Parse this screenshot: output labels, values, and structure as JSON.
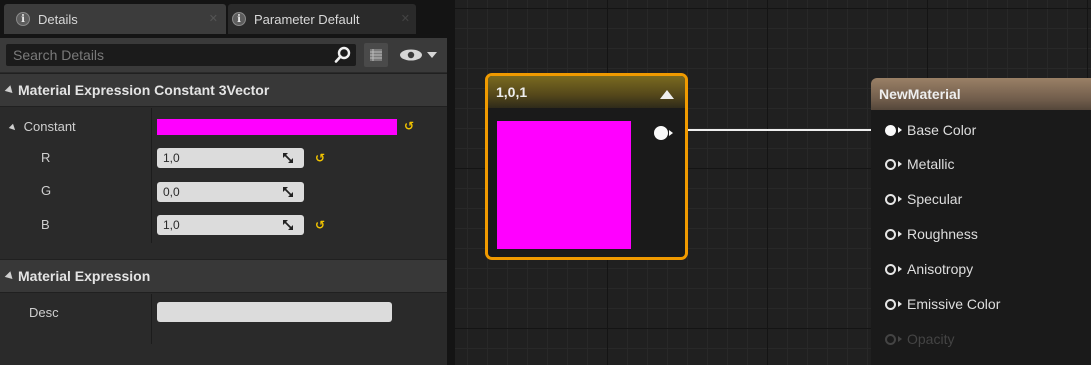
{
  "details_panel": {
    "tabs": [
      {
        "label": "Details",
        "icon": "info-icon"
      },
      {
        "label": "Parameter Default",
        "icon": "info-icon"
      }
    ],
    "search": {
      "placeholder": "Search Details",
      "value": ""
    },
    "categories": [
      {
        "title": "Material Expression Constant 3Vector",
        "properties": [
          {
            "label": "Constant",
            "value_color": "#ff00ff"
          },
          {
            "label": "R",
            "value": "1,0"
          },
          {
            "label": "G",
            "value": "0,0"
          },
          {
            "label": "B",
            "value": "1,0"
          }
        ]
      },
      {
        "title": "Material Expression",
        "properties": [
          {
            "label": "Desc",
            "value": ""
          }
        ]
      }
    ]
  },
  "graph": {
    "constant_node": {
      "title": "1,0,1",
      "preview_color": "#ff00ff"
    },
    "material_node": {
      "title": "NewMaterial",
      "pins": [
        {
          "label": "Base Color",
          "connected": true
        },
        {
          "label": "Metallic"
        },
        {
          "label": "Specular"
        },
        {
          "label": "Roughness"
        },
        {
          "label": "Anisotropy"
        },
        {
          "label": "Emissive Color"
        },
        {
          "label": "Opacity",
          "disabled": true
        }
      ]
    }
  },
  "colors": {
    "selection_outline": "#f09a00",
    "magenta": "#ff00ff",
    "reset_arrow": "#f2c400"
  }
}
